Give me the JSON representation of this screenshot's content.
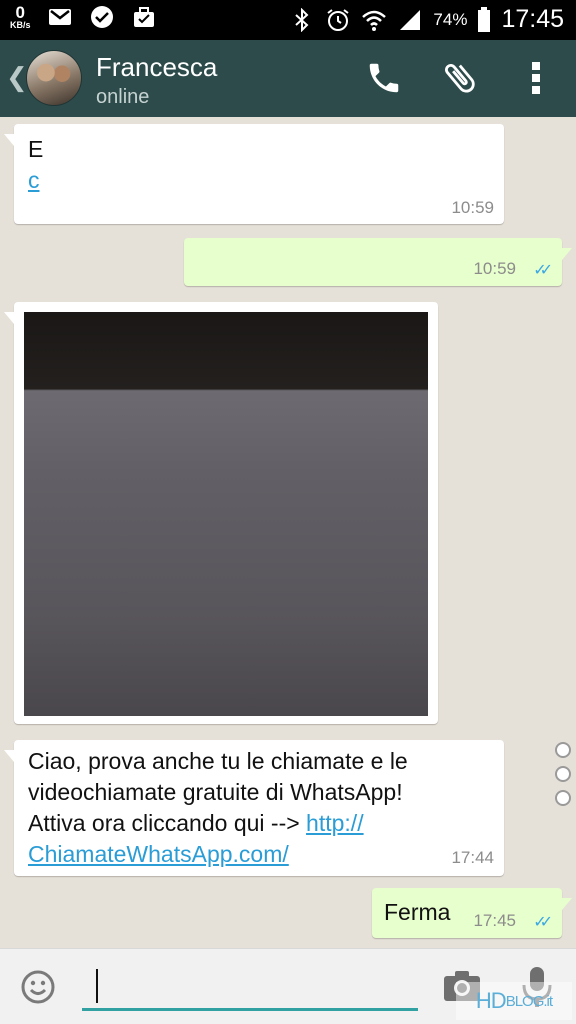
{
  "status_bar": {
    "speed_value": "0",
    "speed_unit": "KB/s",
    "battery": "74%",
    "time": "17:45",
    "icons": [
      "gmail-icon",
      "check-circle-icon",
      "briefcase-icon",
      "bluetooth-icon",
      "alarm-icon",
      "wifi-icon",
      "signal-icon",
      "battery-icon"
    ]
  },
  "header": {
    "contact_name": "Francesca",
    "contact_status": "online",
    "icons": [
      "back-chevron-icon",
      "phone-icon",
      "paperclip-icon",
      "overflow-menu-icon"
    ]
  },
  "messages": [
    {
      "direction": "incoming",
      "lines": [
        "E"
      ],
      "link": "c",
      "time": "10:59"
    },
    {
      "direction": "outgoing",
      "lines": [],
      "time": "10:59",
      "ticks": "read"
    },
    {
      "direction": "incoming",
      "type": "image",
      "time": ""
    },
    {
      "direction": "incoming",
      "lines": [
        "Ciao, prova anche tu le chiamate e le",
        "videochiamate gratuite di WhatsApp!",
        "Attiva ora cliccando qui -->"
      ],
      "link_part1": "http://",
      "link_part2": "ChiamateWhatsApp.com/",
      "time": "17:44"
    },
    {
      "direction": "outgoing",
      "lines": [
        "Ferma"
      ],
      "time": "17:45",
      "ticks": "read"
    }
  ],
  "input_bar": {
    "placeholder": "",
    "icons": [
      "emoji-icon",
      "camera-icon",
      "microphone-icon"
    ]
  },
  "watermark": {
    "main": "HD",
    "blog": "BLOG",
    "tld": ".it"
  },
  "colors": {
    "header": "#2d4b4b",
    "outgoing_bubble": "#e7fecd",
    "link": "#2a9cd6",
    "read_ticks": "#3aa8e4",
    "input_underline": "#31a2a1"
  }
}
